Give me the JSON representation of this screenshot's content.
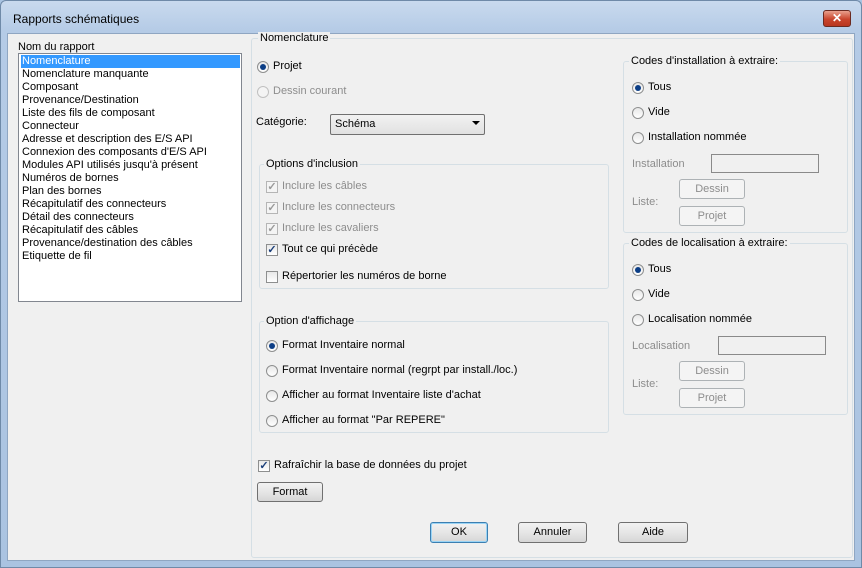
{
  "window": {
    "title": "Rapports schématiques",
    "close_glyph": "✕"
  },
  "report_list": {
    "label": "Nom du rapport",
    "items": [
      "Nomenclature",
      "Nomenclature manquante",
      "Composant",
      "Provenance/Destination",
      "Liste des fils de composant",
      "Connecteur",
      "Adresse et description des E/S API",
      "Connexion des composants d'E/S API",
      "Modules API utilisés jusqu'à présent",
      "Numéros de bornes",
      "Plan des bornes",
      "Récapitulatif des connecteurs",
      "Détail des connecteurs",
      "Récapitulatif des câbles",
      "Provenance/destination des câbles",
      "Etiquette de fil"
    ],
    "selected": "Nomenclature"
  },
  "nomenclature": {
    "group_label": "Nomenclature",
    "projet_label": "Projet",
    "dessin_label": "Dessin courant",
    "categorie_label": "Catégorie:",
    "categorie_value": "Schéma"
  },
  "inclusion": {
    "group_label": "Options d'inclusion",
    "cables_label": "Inclure les câbles",
    "connecteurs_label": "Inclure les connecteurs",
    "cavaliers_label": "Inclure les cavaliers",
    "tout_label": "Tout ce qui précède",
    "bornes_label": "Répertorier les numéros de borne"
  },
  "affichage": {
    "group_label": "Option d'affichage",
    "opt1": "Format Inventaire normal",
    "opt2": "Format Inventaire normal (regrpt par install./loc.)",
    "opt3": "Afficher au format Inventaire liste d'achat",
    "opt4": "Afficher au format \"Par REPERE\""
  },
  "installation": {
    "group_label": "Codes d'installation à extraire:",
    "tous_label": "Tous",
    "vide_label": "Vide",
    "nommee_label": "Installation nommée",
    "field_label": "Installation",
    "liste_label": "Liste:",
    "dessin_button": "Dessin",
    "projet_button": "Projet"
  },
  "localisation": {
    "group_label": "Codes de localisation à extraire:",
    "tous_label": "Tous",
    "vide_label": "Vide",
    "nommee_label": "Localisation nommée",
    "field_label": "Localisation",
    "liste_label": "Liste:",
    "dessin_button": "Dessin",
    "projet_button": "Projet"
  },
  "refresh_label": "Rafraîchir la base de données du projet",
  "checkmark": "✓",
  "buttons": {
    "format": "Format",
    "ok": "OK",
    "cancel": "Annuler",
    "help": "Aide"
  }
}
